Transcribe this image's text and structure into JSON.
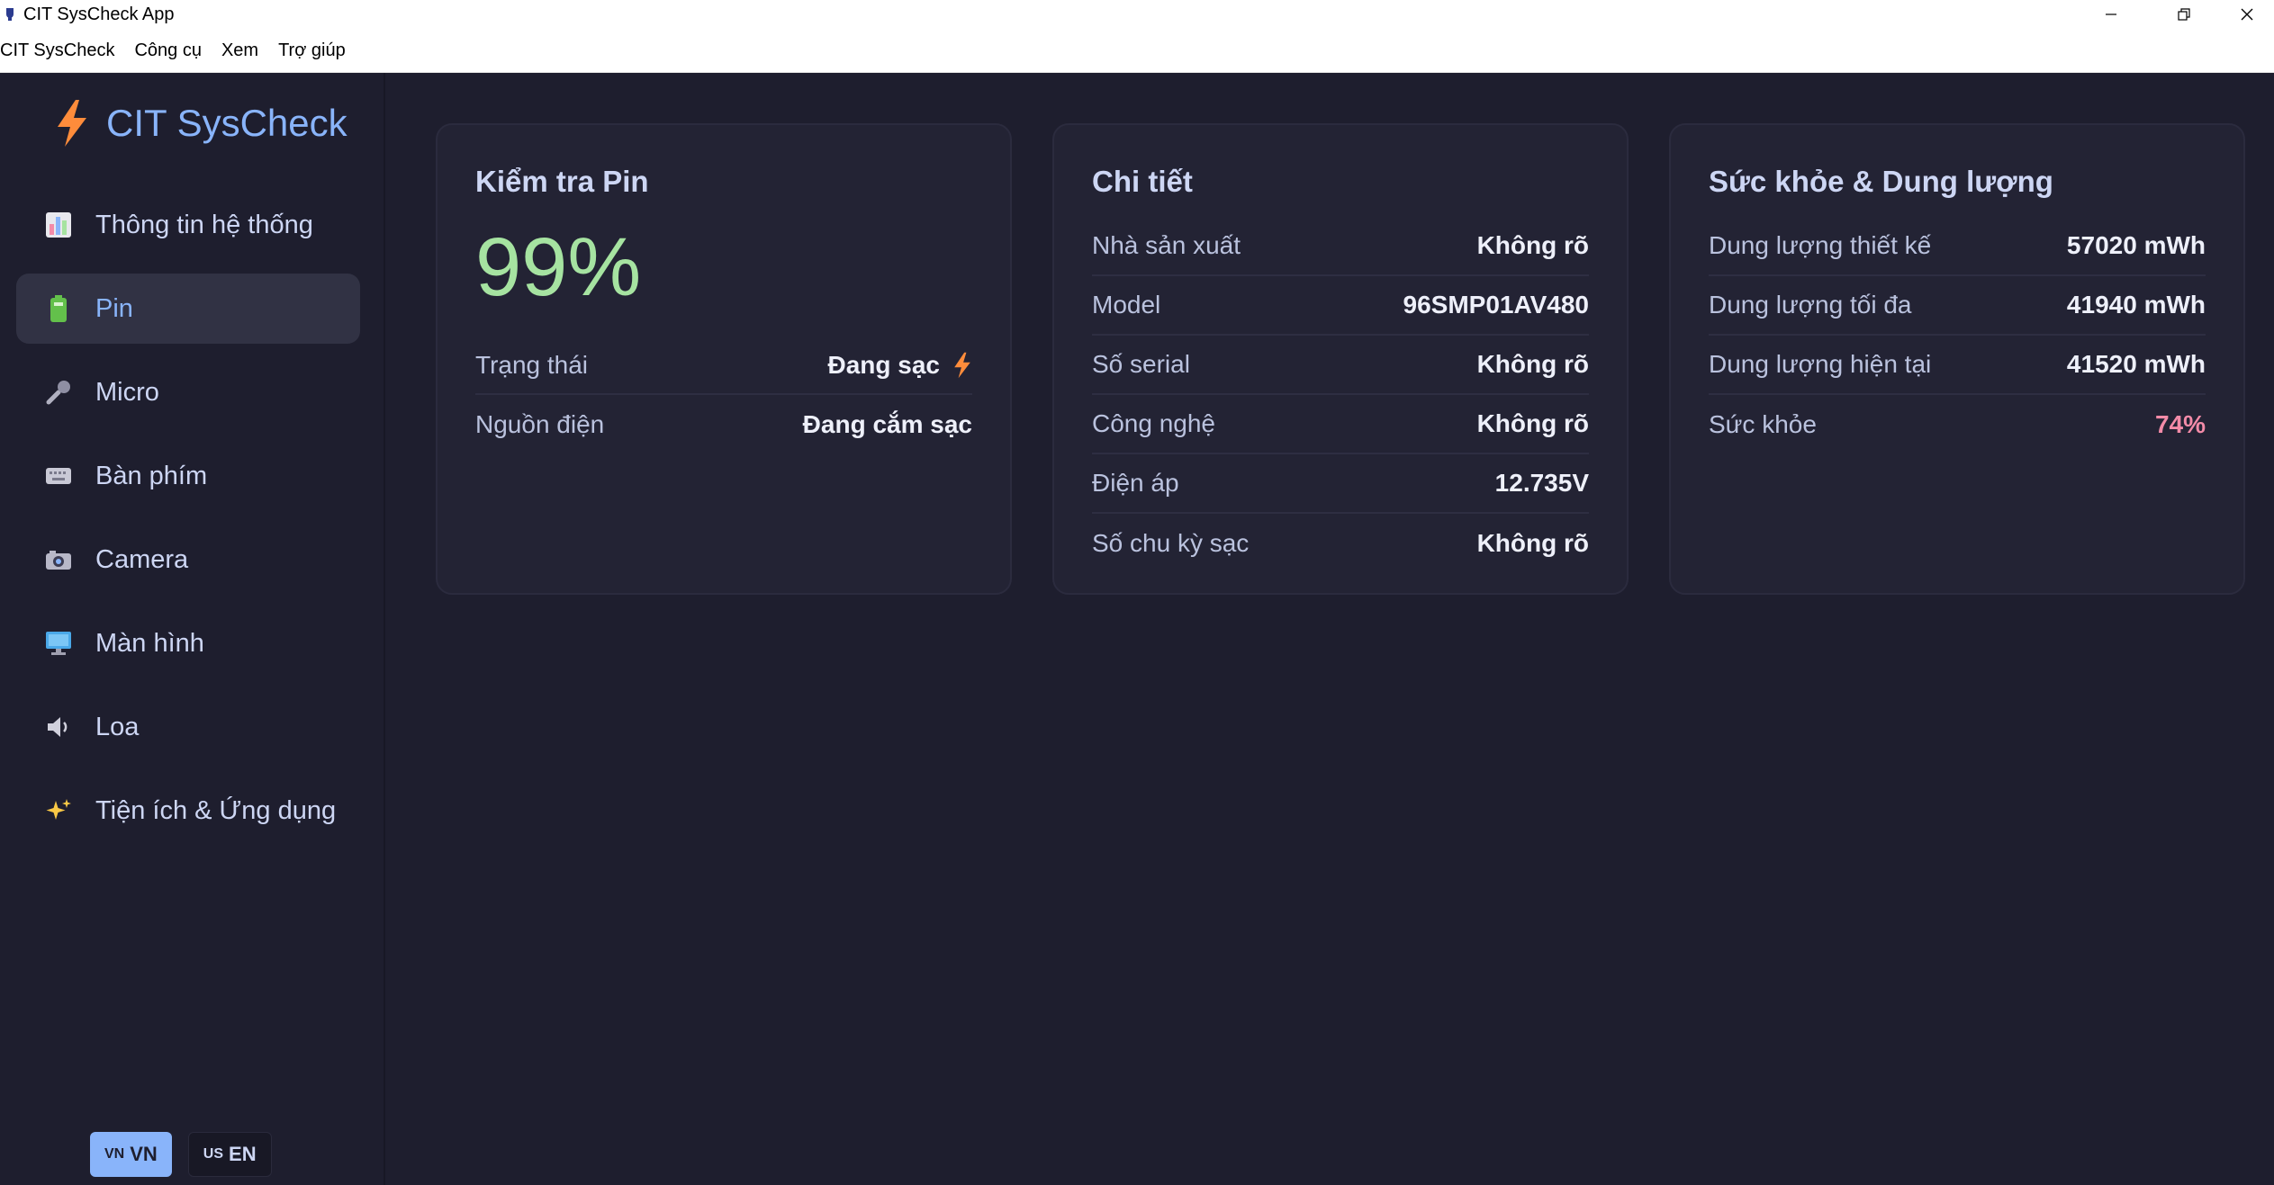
{
  "window": {
    "title": "CIT SysCheck App"
  },
  "menubar": [
    "CIT SysCheck",
    "Công cụ",
    "Xem",
    "Trợ giúp"
  ],
  "sidebar": {
    "brand": "CIT SysCheck",
    "items": [
      {
        "label": "Thông tin hệ thống",
        "icon": "bar-chart-icon",
        "active": false
      },
      {
        "label": "Pin",
        "icon": "battery-icon",
        "active": true
      },
      {
        "label": "Micro",
        "icon": "microphone-icon",
        "active": false
      },
      {
        "label": "Bàn phím",
        "icon": "keyboard-icon",
        "active": false
      },
      {
        "label": "Camera",
        "icon": "camera-icon",
        "active": false
      },
      {
        "label": "Màn hình",
        "icon": "monitor-icon",
        "active": false
      },
      {
        "label": "Loa",
        "icon": "speaker-icon",
        "active": false
      },
      {
        "label": "Tiện ích & Ứng dụng",
        "icon": "sparkles-icon",
        "active": false
      }
    ],
    "lang": [
      {
        "flag": "VN",
        "label": "VN",
        "active": true
      },
      {
        "flag": "US",
        "label": "EN",
        "active": false
      }
    ]
  },
  "battery_card": {
    "title": "Kiểm tra Pin",
    "percent": "99%",
    "rows": [
      {
        "label": "Trạng thái",
        "value": "Đang sạc"
      },
      {
        "label": "Nguồn điện",
        "value": "Đang cắm sạc"
      }
    ]
  },
  "details_card": {
    "title": "Chi tiết",
    "rows": [
      {
        "label": "Nhà sản xuất",
        "value": "Không rõ"
      },
      {
        "label": "Model",
        "value": "96SMP01AV480"
      },
      {
        "label": "Số serial",
        "value": "Không rõ"
      },
      {
        "label": "Công nghệ",
        "value": "Không rõ"
      },
      {
        "label": "Điện áp",
        "value": "12.735V"
      },
      {
        "label": "Số chu kỳ sạc",
        "value": "Không rõ"
      }
    ]
  },
  "health_card": {
    "title": "Sức khỏe & Dung lượng",
    "rows": [
      {
        "label": "Dung lượng thiết kế",
        "value": "57020 mWh"
      },
      {
        "label": "Dung lượng tối đa",
        "value": "41940 mWh"
      },
      {
        "label": "Dung lượng hiện tại",
        "value": "41520 mWh"
      },
      {
        "label": "Sức khỏe",
        "value": "74%"
      }
    ]
  },
  "colors": {
    "accent": "#89b4fa",
    "good": "#a6e3a1",
    "warn": "#f38ba8",
    "bolt": "#fe8c3b",
    "bg": "#1e1e2e",
    "card": "#232334"
  }
}
